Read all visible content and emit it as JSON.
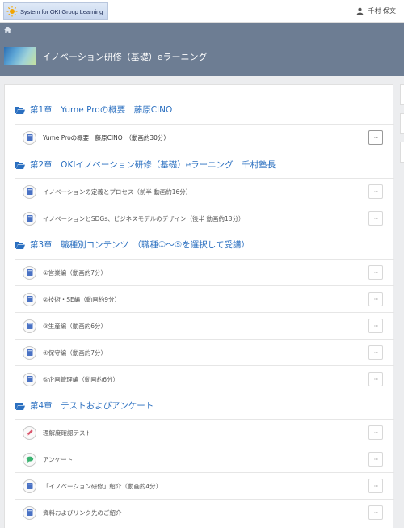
{
  "header": {
    "logo_text": "System for OKI Group Learning",
    "user_name": "千村 保文",
    "course_title": "イノベーション研修（基礎）eラーニング"
  },
  "chapters": [
    {
      "title": "第1章　Yume Proの概要　藤原CINO",
      "items": [
        {
          "label": "Yume Proの概要　藤原CINO　（動画約30分）",
          "icon": "book-icon"
        }
      ]
    },
    {
      "title": "第2章　OKIイノベーション研修（基礎）eラーニング　千村塾長",
      "items": [
        {
          "label": "イノベーションの定義とプロセス（前半 動画約16分）",
          "icon": "book-icon"
        },
        {
          "label": "イノベーションとSDGs、ビジネスモデルのデザイン（後半 動画約13分）",
          "icon": "book-icon"
        }
      ]
    },
    {
      "title": "第3章　職種別コンテンツ　（職種①～⑤を選択して受講）",
      "items": [
        {
          "label": "①営業編（動画約7分）",
          "icon": "book-icon"
        },
        {
          "label": "②技術・SE編（動画約9分）",
          "icon": "book-icon"
        },
        {
          "label": "③生産編（動画約6分）",
          "icon": "book-icon"
        },
        {
          "label": "④保守編（動画約7分）",
          "icon": "book-icon"
        },
        {
          "label": "⑤企画管理編（動画約6分）",
          "icon": "book-icon"
        }
      ]
    },
    {
      "title": "第4章　テストおよびアンケート",
      "items": [
        {
          "label": "理解度確認テスト",
          "icon": "pencil-icon"
        },
        {
          "label": "アンケート",
          "icon": "chat-icon"
        },
        {
          "label": "「イノベーション研修」紹介（動画約4分）",
          "icon": "book-icon"
        },
        {
          "label": "資料およびリンク先のご紹介",
          "icon": "book-icon"
        }
      ]
    }
  ],
  "more_button_label": "···",
  "colors": {
    "accent": "#2a6fc0",
    "header_band": "#6d7d93",
    "book": "#4a72c4",
    "pencil": "#d9556b",
    "chat": "#3cb371"
  }
}
